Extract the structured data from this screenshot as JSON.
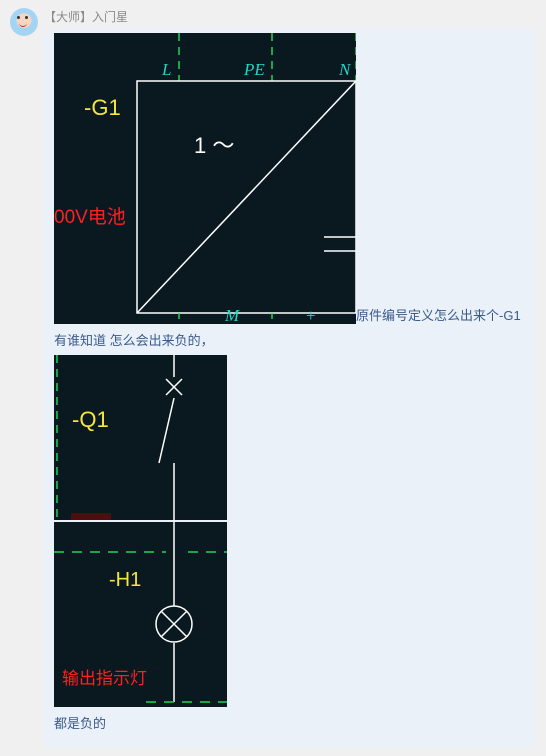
{
  "user": {
    "label": "【大师】入门星"
  },
  "msg": {
    "text_after_img1": "原件编号定义怎么出来个-G1",
    "text_line2": "有谁知道 怎么会出来负的，",
    "text_line3": "都是负的"
  },
  "cad1": {
    "label_L": "L",
    "label_PE": "PE",
    "label_N": "N",
    "label_G1": "-G1",
    "label_1wave": "1 ～",
    "label_battery": "00V电池",
    "label_M": "M",
    "label_plus": "+"
  },
  "cad2": {
    "label_Q1": "-Q1"
  },
  "cad3": {
    "label_H1": "-H1",
    "label_output": "输出指示灯"
  }
}
